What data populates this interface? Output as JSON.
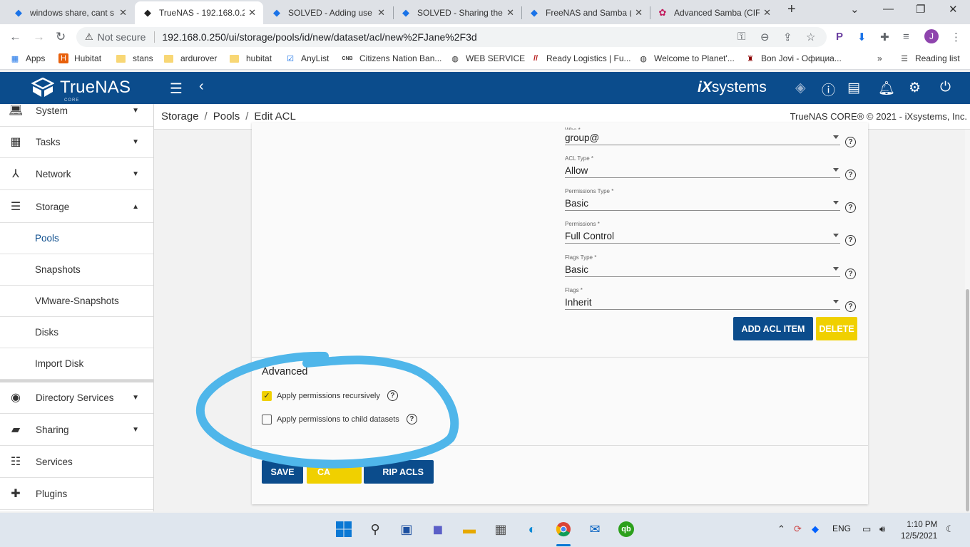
{
  "browser": {
    "tabs": [
      {
        "title": "windows share, cant s"
      },
      {
        "title": "TrueNAS - 192.168.0.2"
      },
      {
        "title": "SOLVED - Adding use"
      },
      {
        "title": "SOLVED - Sharing the"
      },
      {
        "title": "FreeNAS and Samba ("
      },
      {
        "title": "Advanced Samba (CIF"
      }
    ],
    "security_label": "Not secure",
    "url": "192.168.0.250/ui/storage/pools/id/new/dataset/acl/new%2FJane%2F3d",
    "bookmarks": [
      "Apps",
      "Hubitat",
      "stans",
      "ardurover",
      "hubitat",
      "AnyList",
      "Citizens Nation Ban...",
      "WEB SERVICE",
      "Ready Logistics | Fu...",
      "Welcome to Planet'...",
      "Bon Jovi - Официа..."
    ],
    "reading_list": "Reading list",
    "profile_initial": "J"
  },
  "app": {
    "logo_text": "TrueNAS",
    "logo_sub": "CORE",
    "brand": "iXsystems",
    "brand_ix": "iX",
    "brand_rest": "systems"
  },
  "sidebar": {
    "items": [
      {
        "label": "System"
      },
      {
        "label": "Tasks"
      },
      {
        "label": "Network"
      },
      {
        "label": "Storage"
      },
      {
        "label": "Directory Services"
      },
      {
        "label": "Sharing"
      },
      {
        "label": "Services"
      },
      {
        "label": "Plugins"
      }
    ],
    "storage_sub": [
      "Pools",
      "Snapshots",
      "VMware-Snapshots",
      "Disks",
      "Import Disk"
    ]
  },
  "breadcrumb": {
    "items": [
      "Storage",
      "Pools",
      "Edit ACL"
    ],
    "copyright": "TrueNAS CORE® © 2021 - iXsystems, Inc."
  },
  "form": {
    "fields": [
      {
        "label": "Who *",
        "value": "group@"
      },
      {
        "label": "ACL Type *",
        "value": "Allow"
      },
      {
        "label": "Permissions Type *",
        "value": "Basic"
      },
      {
        "label": "Permissions *",
        "value": "Full Control"
      },
      {
        "label": "Flags Type *",
        "value": "Basic"
      },
      {
        "label": "Flags *",
        "value": "Inherit"
      }
    ],
    "add_acl_item": "ADD ACL ITEM",
    "delete": "DELETE",
    "advanced_title": "Advanced",
    "apply_recursively": "Apply permissions recursively",
    "apply_recursively_checked": true,
    "apply_child": "Apply permissions to child datasets",
    "apply_child_checked": false,
    "save": "SAVE",
    "cancel": "CA",
    "strip": "RIP ACLS"
  },
  "annotation": {
    "color": "#4fb6ea"
  },
  "taskbar": {
    "lang": "ENG",
    "time": "1:10 PM",
    "date": "12/5/2021"
  },
  "colors": {
    "accent": "#0b4c8c",
    "warn": "#f0d000"
  }
}
